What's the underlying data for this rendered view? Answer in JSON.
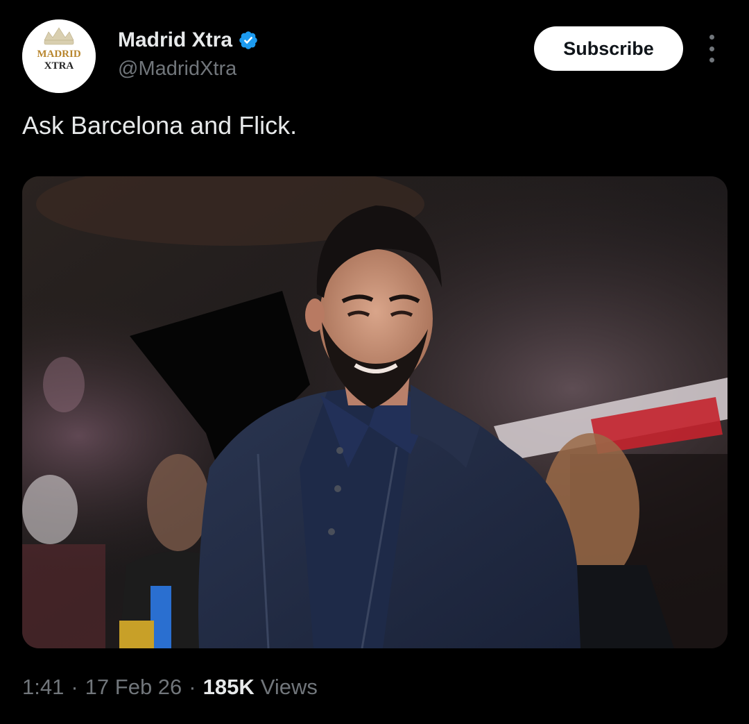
{
  "author": {
    "name": "Madrid Xtra",
    "handle": "@MadridXtra",
    "avatar_icon": "madrid-xtra-logo",
    "verified_icon": "verified-badge-icon",
    "verified_color": "#1d9bf0",
    "avatar_logo_text": [
      "MADRID",
      "XTRA"
    ]
  },
  "actions": {
    "subscribe_label": "Subscribe",
    "more_icon": "more-vertical-icon"
  },
  "tweet": {
    "text": "Ask Barcelona and Flick.",
    "media_description_icon": "photo"
  },
  "meta": {
    "time": "1:41",
    "date": "17 Feb 26",
    "views_count": "185K",
    "views_label": "Views"
  },
  "colors": {
    "background": "#000000",
    "text_primary": "#e7e9ea",
    "text_secondary": "#71767b",
    "button_bg": "#ffffff"
  }
}
